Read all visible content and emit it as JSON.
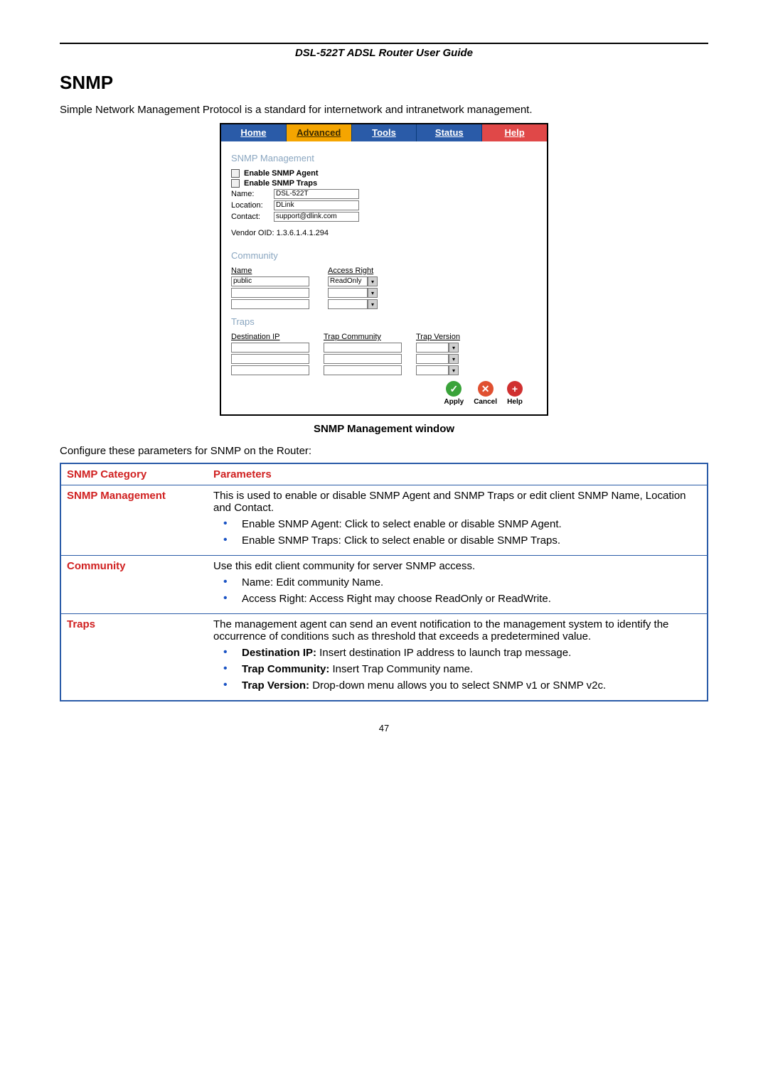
{
  "header": {
    "title": "DSL-522T ADSL Router User Guide"
  },
  "section": {
    "title": "SNMP"
  },
  "intro": "Simple Network Management Protocol is a standard for internetwork and intranetwork management.",
  "screenshot": {
    "tabs": {
      "home": "Home",
      "advanced": "Advanced",
      "tools": "Tools",
      "status": "Status",
      "help": "Help"
    },
    "mgmt": {
      "heading": "SNMP Management",
      "enable_agent": "Enable SNMP Agent",
      "enable_traps": "Enable SNMP Traps",
      "name_lbl": "Name:",
      "name_val": "DSL-522T",
      "loc_lbl": "Location:",
      "loc_val": "DLink",
      "contact_lbl": "Contact:",
      "contact_val": "support@dlink.com",
      "vendor": "Vendor OID: 1.3.6.1.4.1.294"
    },
    "community": {
      "heading": "Community",
      "name_hdr": "Name",
      "access_hdr": "Access Right",
      "rows": [
        {
          "name": "public",
          "access": "ReadOnly"
        },
        {
          "name": "",
          "access": ""
        },
        {
          "name": "",
          "access": ""
        }
      ]
    },
    "traps": {
      "heading": "Traps",
      "dest_hdr": "Destination IP",
      "comm_hdr": "Trap Community",
      "ver_hdr": "Trap Version"
    },
    "actions": {
      "apply": "Apply",
      "cancel": "Cancel",
      "help": "Help"
    }
  },
  "caption": "SNMP Management window",
  "configure": "Configure these parameters for SNMP on the Router:",
  "table": {
    "hdr_cat": "SNMP Category",
    "hdr_par": "Parameters",
    "mgmt": {
      "label": "SNMP Management",
      "desc": "This is used to enable or disable SNMP Agent and SNMP Traps or edit client SNMP Name, Location and Contact.",
      "b1": "Enable SNMP Agent: Click to select enable or disable SNMP Agent.",
      "b2": "Enable SNMP Traps: Click to select enable or disable SNMP Traps."
    },
    "community": {
      "label": "Community",
      "desc": "Use this edit client community for server SNMP access.",
      "b1": "Name: Edit community Name.",
      "b2": "Access Right: Access Right may choose ReadOnly or ReadWrite."
    },
    "traps": {
      "label": "Traps",
      "desc": "The management agent can send an event notification to the management system to identify the occurrence of conditions such as threshold that exceeds a predetermined value.",
      "b1_bold": "Destination IP:",
      "b1_rest": " Insert destination IP address to launch trap message.",
      "b2_bold": "Trap Community:",
      "b2_rest": " Insert Trap Community name.",
      "b3_bold": "Trap Version:",
      "b3_rest": " Drop-down menu allows you to select SNMP v1 or SNMP v2c."
    }
  },
  "page": "47"
}
